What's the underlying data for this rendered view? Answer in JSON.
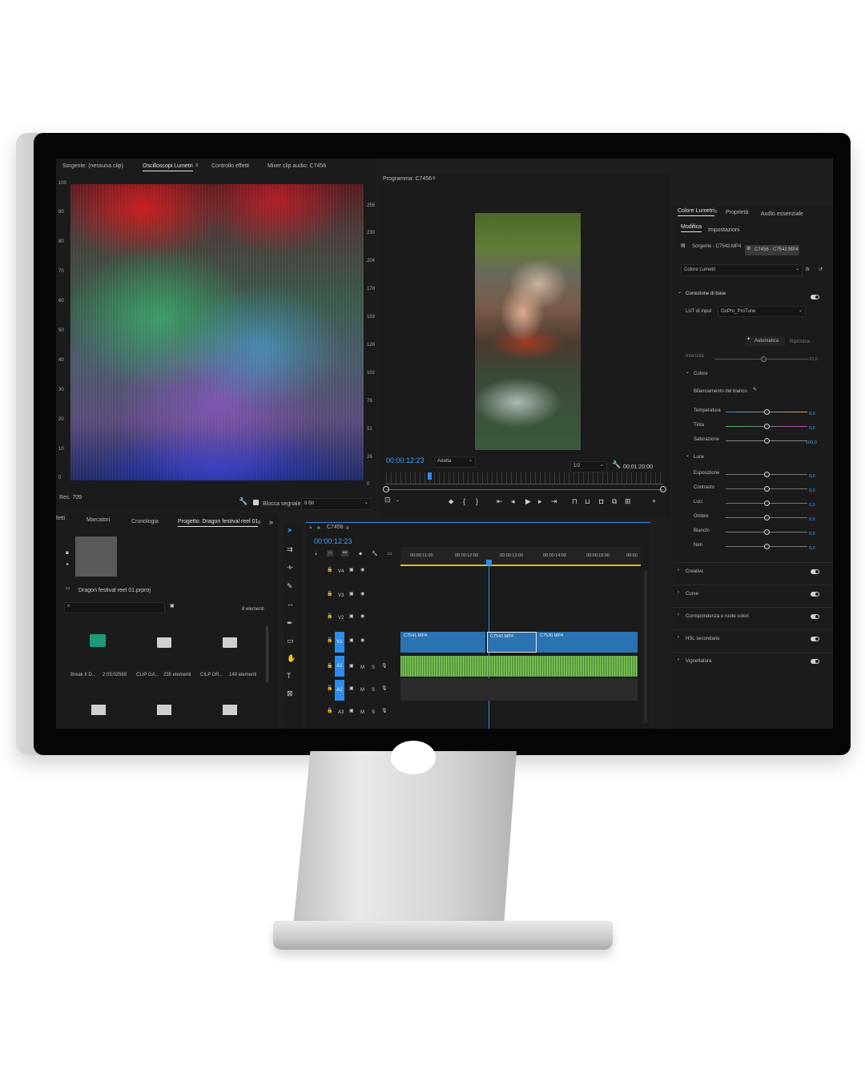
{
  "scopes": {
    "tabs": [
      "Sorgente: (nessuna clip)",
      "Oscilloscopi Lumetri",
      "Controllo effetti",
      "Mixer clip audio: C7456"
    ],
    "left_scale": [
      "100",
      "90",
      "80",
      "70",
      "60",
      "50",
      "40",
      "30",
      "20",
      "10",
      "0"
    ],
    "right_scale": [
      "255",
      "230",
      "204",
      "178",
      "153",
      "128",
      "102",
      "76",
      "51",
      "26",
      "0"
    ],
    "footer_left": "Rec. 709",
    "block_signal": "Blocca segnale",
    "bit_depth": "8 Bit"
  },
  "program": {
    "title": "Programma: C7456",
    "timecode": "00:00:12:23",
    "fit": "Adatta",
    "resolution": "1/2",
    "duration": "00:01:20:00"
  },
  "project": {
    "tabs": [
      "fetti",
      "Marcatori",
      "Cronologia",
      "Progetto: Dragon festival reel 01"
    ],
    "file": "Dragon festival reel 01.prproj",
    "count": "8 elementi",
    "items": [
      {
        "name": "Break It D...",
        "meta": "2:05:02569",
        "icon": "audio-clip-icon"
      },
      {
        "name": "CLIP GA...",
        "meta": "235 elementi",
        "icon": "folder-icon"
      },
      {
        "name": "CILP DR...",
        "meta": "149 elementi",
        "icon": "folder-icon"
      }
    ]
  },
  "timeline": {
    "sequence": "C7456",
    "timecode": "00:00:12:23",
    "ruler": [
      "00:00:11:00",
      "00:00:12:00",
      "00:00:13:00",
      "00:00:14:00",
      "00:00:15:00",
      "00:00"
    ],
    "video_tracks": [
      "V4",
      "V3",
      "V2",
      "V1"
    ],
    "audio_tracks": [
      "A1",
      "A2",
      "A3"
    ],
    "clips": [
      "C7541.MP4",
      "C7542.MP4",
      "C7530.MP4"
    ],
    "track_m": "M",
    "track_s": "S"
  },
  "lumetri": {
    "tabs": [
      "Colore Lumetri",
      "Proprietà",
      "Audio essenziale"
    ],
    "subtabs": [
      "Modifica",
      "Impostazioni"
    ],
    "source": "Sorgente - C7542.MP4",
    "sequence": "C7456 - C7542.MP4",
    "effect": "Colore Lumetri",
    "basic": "Correzione di base",
    "lut_label": "LUT di input",
    "lut_value": "GoPro_ProTune",
    "auto": "Automatica",
    "reset": "Ripristina",
    "intensity": "Intensità",
    "intensity_value": "10,0",
    "color_section": "Colore",
    "white_balance": "Bilanciamento del bianco",
    "color_sliders": [
      {
        "label": "Temperatura",
        "value": "0,0"
      },
      {
        "label": "Tinta",
        "value": "0,0"
      },
      {
        "label": "Saturazione",
        "value": "100,0"
      }
    ],
    "light_section": "Luce",
    "light_sliders": [
      {
        "label": "Esposizione",
        "value": "0,0"
      },
      {
        "label": "Contrasto",
        "value": "0,0"
      },
      {
        "label": "Luci",
        "value": "0,0"
      },
      {
        "label": "Ombre",
        "value": "0,0"
      },
      {
        "label": "Bianchi",
        "value": "0,0"
      },
      {
        "label": "Neri",
        "value": "0,0"
      }
    ],
    "sections": [
      "Creativo",
      "Curve",
      "Corrispondenza e ruote colori",
      "HSL secondario",
      "Vignettatura"
    ]
  },
  "colors": {
    "accent": "#2d8ceb",
    "clip_video": "#2a73b2",
    "clip_audio": "#4d8a3a",
    "timecode": "#3ea3ff"
  }
}
